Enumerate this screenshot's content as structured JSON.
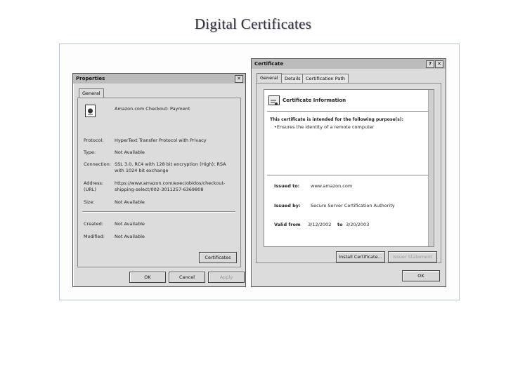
{
  "slide": {
    "title": "Digital Certificates"
  },
  "properties": {
    "title": "Properties",
    "close": "✕",
    "tab": "General",
    "page_title": "Amazon.com Checkout: Payment",
    "rows": [
      {
        "label": "Protocol:",
        "value": "HyperText Transfer Protocol with Privacy"
      },
      {
        "label": "Type:",
        "value": "Not Available"
      },
      {
        "label": "Connection:",
        "value": "SSL 3.0, RC4 with 128 bit encryption (High); RSA\nwith 1024 bit exchange"
      },
      {
        "label": "Address:\n(URL)",
        "value": "https://www.amazon.com/exec/obidos/checkout-\nshipping-select/002-3011257-6369808"
      },
      {
        "label": "Size:",
        "value": "Not Available"
      },
      {
        "label": "Created:",
        "value": "Not Available"
      },
      {
        "label": "Modified:",
        "value": "Not Available"
      }
    ],
    "certificates_button": "Certificates",
    "ok_button": "OK",
    "cancel_button": "Cancel",
    "apply_button": "Apply"
  },
  "certificate": {
    "title": "Certificate",
    "help": "?",
    "close": "✕",
    "tabs": [
      "General",
      "Details",
      "Certification Path"
    ],
    "info_heading": "Certificate Information",
    "purpose_heading": "This certificate is intended for the following purpose(s):",
    "purpose_item": "•Ensures the identity of a remote computer",
    "issued_to_label": "Issued to:",
    "issued_to_value": "www.amazon.com",
    "issued_by_label": "Issued by:",
    "issued_by_value": "Secure Server Certification Authority",
    "valid_from_label": "Valid from",
    "valid_from_value": "3/12/2002",
    "valid_to_label": "to",
    "valid_to_value": "3/20/2003",
    "install_button": "Install Certificate...",
    "issuer_button": "Issuer Statement",
    "ok_button": "OK"
  }
}
